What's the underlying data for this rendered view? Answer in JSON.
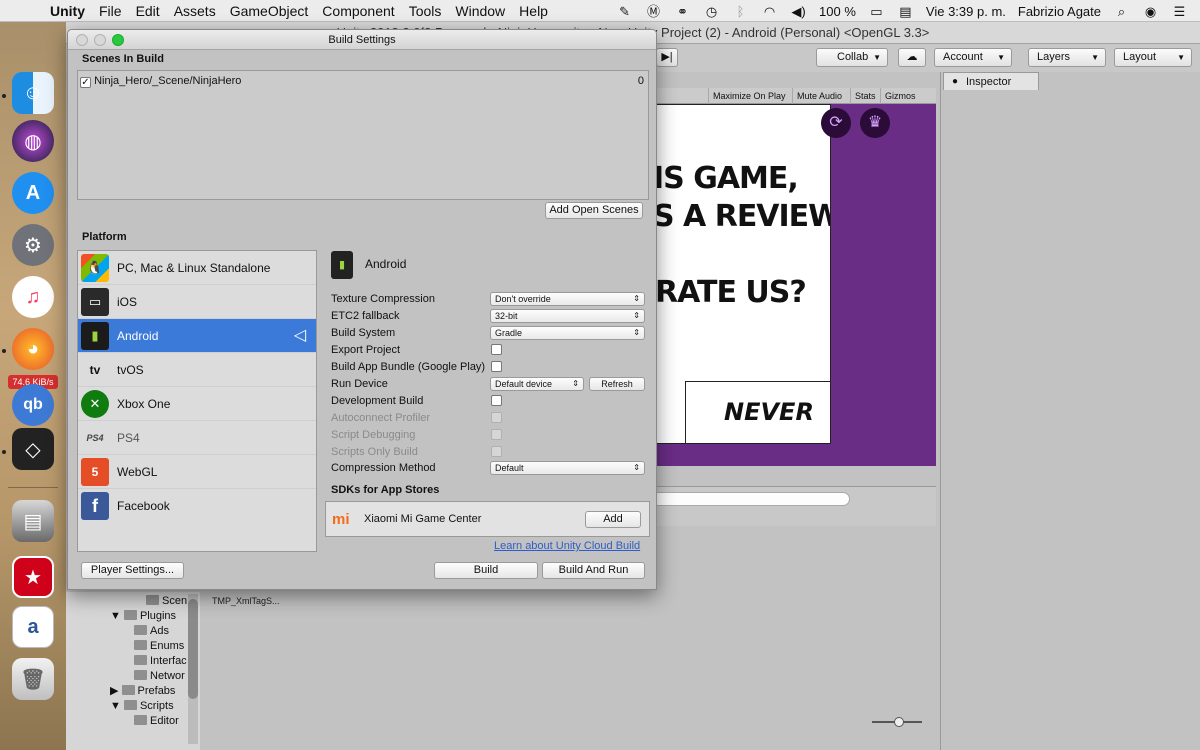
{
  "menubar": {
    "app": "Unity",
    "menus": [
      "File",
      "Edit",
      "Assets",
      "GameObject",
      "Component",
      "Tools",
      "Window",
      "Help"
    ],
    "battery": "100 %",
    "clock": "Vie 3:39 p. m.",
    "user": "Fabrizio Agate"
  },
  "dock": {
    "network_badge": "74.6 KiB/s"
  },
  "unity": {
    "title": "Unity 2018.2.0f2 Personal - NinjaHero.unity - New Unity Project (2) - Android (Personal) <OpenGL 3.3>",
    "toolbar": {
      "collab": "Collab",
      "account": "Account",
      "layers": "Layers",
      "layout": "Layout"
    },
    "game_tabs": [
      "Maximize On Play",
      "Mute Audio",
      "Stats",
      "Gizmos"
    ],
    "game_text": {
      "line1": "IS GAME,",
      "line2": "S A REVIEW.",
      "line3": "RATE US?",
      "never": "NEVER"
    },
    "inspector_tab": "Inspector",
    "project_tree": [
      "Scen",
      "Plugins",
      "Ads",
      "Enums",
      "Interfac",
      "Networ",
      "Prefabs",
      "Scripts",
      "Editor"
    ],
    "project_file": "TMP_XmlTagS..."
  },
  "dialog": {
    "title": "Build Settings",
    "scenes_label": "Scenes In Build",
    "scene": {
      "path": "Ninja_Hero/_Scene/NinjaHero",
      "index": "0",
      "checked": true
    },
    "add_open_scenes": "Add Open Scenes",
    "platform_label": "Platform",
    "platforms": [
      {
        "label": "PC, Mac & Linux Standalone",
        "icon": "pc-mac-linux-icon"
      },
      {
        "label": "iOS",
        "icon": "ios-icon"
      },
      {
        "label": "Android",
        "icon": "android-icon"
      },
      {
        "label": "tvOS",
        "icon": "tvos-icon"
      },
      {
        "label": "Xbox One",
        "icon": "xbox-icon"
      },
      {
        "label": "PS4",
        "icon": "ps4-icon"
      },
      {
        "label": "WebGL",
        "icon": "html5-icon"
      },
      {
        "label": "Facebook",
        "icon": "facebook-icon"
      }
    ],
    "selected_platform": "Android",
    "settings": {
      "texture_compression": {
        "label": "Texture Compression",
        "value": "Don't override"
      },
      "etc2_fallback": {
        "label": "ETC2 fallback",
        "value": "32-bit"
      },
      "build_system": {
        "label": "Build System",
        "value": "Gradle"
      },
      "export_project": {
        "label": "Export Project"
      },
      "build_app_bundle": {
        "label": "Build App Bundle (Google Play)"
      },
      "run_device": {
        "label": "Run Device",
        "value": "Default device",
        "refresh": "Refresh"
      },
      "development_build": {
        "label": "Development Build"
      },
      "autoconnect_profiler": {
        "label": "Autoconnect Profiler"
      },
      "script_debugging": {
        "label": "Script Debugging"
      },
      "scripts_only_build": {
        "label": "Scripts Only Build"
      },
      "compression_method": {
        "label": "Compression Method",
        "value": "Default"
      }
    },
    "sdk_label": "SDKs for App Stores",
    "sdk": {
      "name": "Xiaomi Mi Game Center",
      "add": "Add"
    },
    "cloud_link": "Learn about Unity Cloud Build",
    "player_settings": "Player Settings...",
    "build": "Build",
    "build_and_run": "Build And Run"
  }
}
